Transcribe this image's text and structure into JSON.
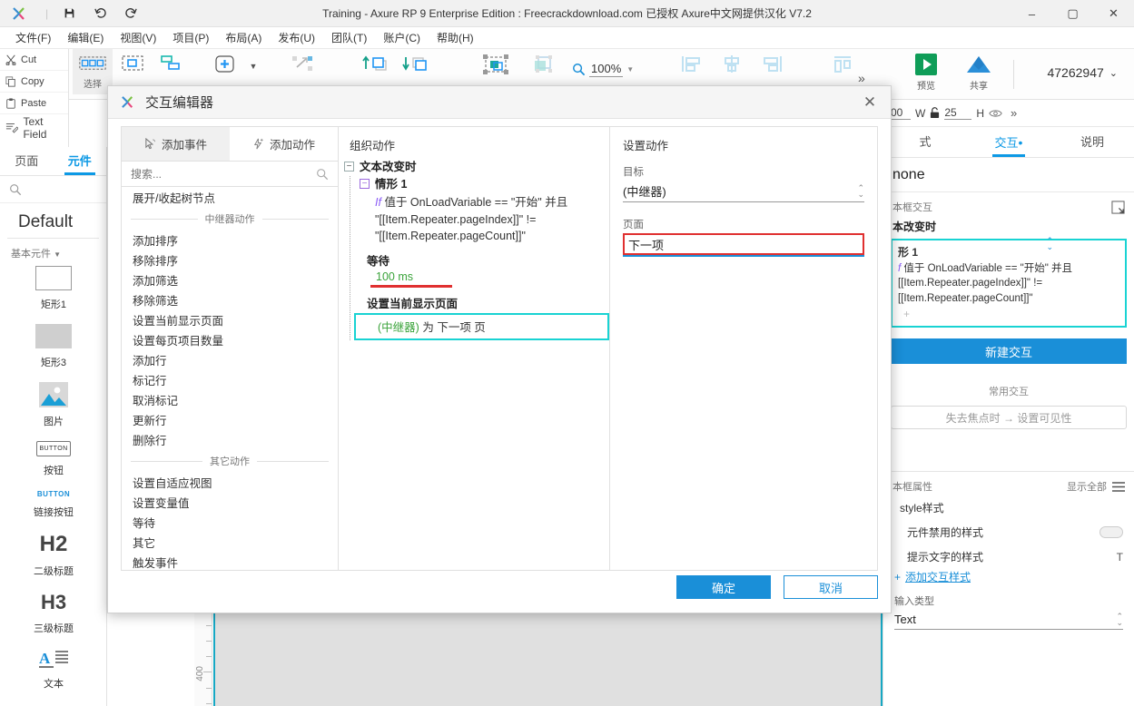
{
  "titlebar": {
    "title": "Training - Axure RP 9 Enterprise Edition : Freecrackdownload.com 已授权    Axure中文网提供汉化 V7.2",
    "icons": {
      "save": "save-icon",
      "undo": "undo-icon",
      "redo": "redo-icon"
    },
    "window_buttons": {
      "minimize": "–",
      "maximize": "▢",
      "close": "✕"
    }
  },
  "menubar": {
    "items": [
      "文件(F)",
      "编辑(E)",
      "视图(V)",
      "项目(P)",
      "布局(A)",
      "发布(U)",
      "团队(T)",
      "账户(C)",
      "帮助(H)"
    ]
  },
  "clipboard": {
    "cut": "Cut",
    "copy": "Copy",
    "paste": "Paste",
    "textfield": "Text Field"
  },
  "toolbar": {
    "select_label": "选择",
    "zoom_value": "100%",
    "preview_label": "预览",
    "share_label": "共享",
    "account_id": "47262947",
    "overflow": "»"
  },
  "left_sidebar": {
    "tabs": [
      {
        "label": "页面",
        "selected": false
      },
      {
        "label": "元件",
        "selected": true
      }
    ],
    "library_name": "Default",
    "group_label": "基本元件",
    "items": [
      {
        "caption": "矩形1",
        "icon": "rectangle-outline-icon"
      },
      {
        "caption": "矩形3",
        "icon": "rectangle-filled-icon"
      },
      {
        "caption": "图片",
        "icon": "image-icon"
      },
      {
        "caption": "按钮",
        "icon": "button-icon"
      },
      {
        "caption": "链接按钮",
        "icon": "link-button-icon"
      },
      {
        "caption": "二级标题",
        "icon": "h2-icon"
      },
      {
        "caption": "三级标题",
        "icon": "h3-icon"
      },
      {
        "caption": "文本",
        "icon": "text-icon"
      }
    ]
  },
  "canvas": {
    "ruler_label_400": "400"
  },
  "right_sidebar": {
    "geometry": {
      "x_partial": "00",
      "w_label": "W",
      "lock_icon": "unlock-icon",
      "h_value": "25",
      "h_label": "H",
      "eye_icon": "eye-icon",
      "overflow": "»"
    },
    "tabs": [
      {
        "label": "式",
        "selected": false
      },
      {
        "label": "交互",
        "selected": true,
        "dot": "•"
      },
      {
        "label": "说明",
        "selected": false
      }
    ],
    "widget_name": "none",
    "section_label": "本框交互",
    "section_icon": "target-icon",
    "event_name": "本改变时",
    "case": {
      "title": "形 1",
      "if_keyword": "f",
      "condition_line1": "值于 OnLoadVariable == \"开始\" 并且",
      "condition_line2": "[[Item.Repeater.pageIndex]]\" !=",
      "condition_line3": "[[Item.Repeater.pageCount]]\"",
      "add": "+"
    },
    "new_interaction": "新建交互",
    "common_label": "常用交互",
    "ghost_suggestion": "失去焦点时 → 设置可见性",
    "props_label": "本框属性",
    "show_all": "显示全部",
    "menu_icon": "hamburger-icon",
    "style_group": "style样式",
    "rows": [
      {
        "label": "元件禁用的样式",
        "control": "toggle"
      },
      {
        "label": "提示文字的样式",
        "control": "T"
      }
    ],
    "add_style": "添加交互样式",
    "input_type_label": "输入类型",
    "input_type_value": "Text"
  },
  "modal": {
    "logo": "axure-logo-icon",
    "title": "交互编辑器",
    "close": "✕",
    "tabs": [
      {
        "label": "添加事件",
        "icon": "cursor-event-icon",
        "selected": true
      },
      {
        "label": "添加动作",
        "icon": "lightning-action-icon",
        "selected": false
      }
    ],
    "search_placeholder": "搜索...",
    "top_item": "展开/收起树节点",
    "group_repeater": "中继器动作",
    "repeater_actions": [
      "添加排序",
      "移除排序",
      "添加筛选",
      "移除筛选",
      "设置当前显示页面",
      "设置每页项目数量",
      "添加行",
      "标记行",
      "取消标记",
      "更新行",
      "删除行"
    ],
    "group_other": "其它动作",
    "other_actions": [
      "设置自适应视图",
      "设置变量值",
      "等待",
      "其它",
      "触发事件"
    ],
    "organize": {
      "title": "组织动作",
      "event": "文本改变时",
      "case_title": "情形 1",
      "if_keyword": "If",
      "condition_line1": "值于 OnLoadVariable == \"开始\" 并且",
      "condition_line2": "\"[[Item.Repeater.pageIndex]]\" !=",
      "condition_line3": "\"[[Item.Repeater.pageCount]]\"",
      "action1_name": "等待",
      "action1_value": "100 ms",
      "action2_name": "设置当前显示页面",
      "action2_target": "(中继器)",
      "action2_mid": "为",
      "action2_value": "下一项 页"
    },
    "settings": {
      "title": "设置动作",
      "target_label": "目标",
      "target_value": "(中继器)",
      "page_label": "页面",
      "page_value": "下一项"
    },
    "ok": "确定",
    "cancel": "取消"
  }
}
